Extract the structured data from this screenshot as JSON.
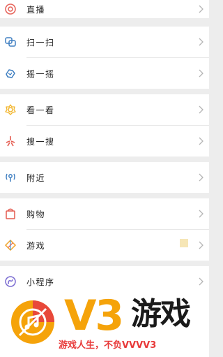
{
  "colors": {
    "background": "#ededed",
    "row_bg": "#ffffff",
    "text": "#1f1f1f",
    "chevron": "#b5b5b5",
    "v3": "#f5a30a",
    "slogan": "#e83a3a"
  },
  "menu": {
    "live": {
      "label": "直播",
      "icon": "live-circle-icon"
    },
    "scan": {
      "label": "扫一扫",
      "icon": "scan-icon"
    },
    "shake": {
      "label": "摇一摇",
      "icon": "shake-icon"
    },
    "top_stories": {
      "label": "看一看",
      "icon": "top-stories-icon"
    },
    "search": {
      "label": "搜一搜",
      "icon": "search-star-icon"
    },
    "nearby": {
      "label": "附近",
      "icon": "nearby-icon"
    },
    "shopping": {
      "label": "购物",
      "icon": "shopping-bag-icon"
    },
    "games": {
      "label": "游戏",
      "icon": "game-diamond-icon"
    },
    "mini_programs": {
      "label": "小程序",
      "icon": "mini-program-icon"
    }
  },
  "watermark": {
    "v3": "V3",
    "brand": "游戏",
    "slogan": "游戏人生，不负VVVV3"
  }
}
